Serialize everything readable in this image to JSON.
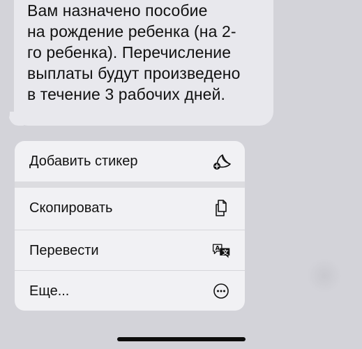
{
  "message": {
    "text": "Вам назначено пособие\nна рождение ребенка (на 2-\nго ребенка). Перечисление\nвыплаты будут произведено\nв течение 3 рабочих дней."
  },
  "menu": {
    "items": [
      {
        "label": "Добавить стикер",
        "icon": "sticker-add-icon"
      },
      {
        "label": "Скопировать",
        "icon": "copy-icon"
      },
      {
        "label": "Перевести",
        "icon": "translate-icon"
      },
      {
        "label": "Еще...",
        "icon": "more-icon"
      }
    ]
  },
  "colors": {
    "background": "#d3d3d9",
    "bubble": "#e8e8ed",
    "menu": "#f1f1f4",
    "text": "#111111"
  }
}
